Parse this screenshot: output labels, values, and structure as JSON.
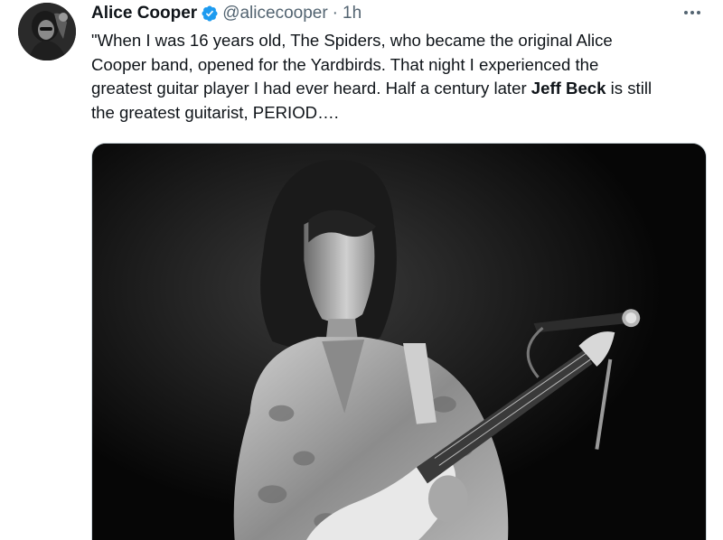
{
  "tweet": {
    "author": {
      "display_name": "Alice Cooper",
      "handle": "@alicecooper",
      "verified": true,
      "avatar_icon": "profile-avatar"
    },
    "separator": "·",
    "time": "1h",
    "text": {
      "line1": "\"When I was 16 years old, The Spiders, who became the original Alice",
      "line2": "Cooper band, opened for the Yardbirds.  That night I experienced the",
      "line3": "greatest guitar player I had ever heard.  Half a century later ",
      "line3_bold": "Jeff Beck",
      "line3_end": " is still",
      "line4": "the greatest guitarist, PERIOD…."
    },
    "more_icon": "more-options-icon",
    "media": {
      "type": "photo",
      "style": "black-and-white"
    }
  },
  "colors": {
    "text": "#0f1419",
    "secondary": "#536471",
    "verified_blue": "#1d9bf0",
    "border": "#cfd9de"
  }
}
